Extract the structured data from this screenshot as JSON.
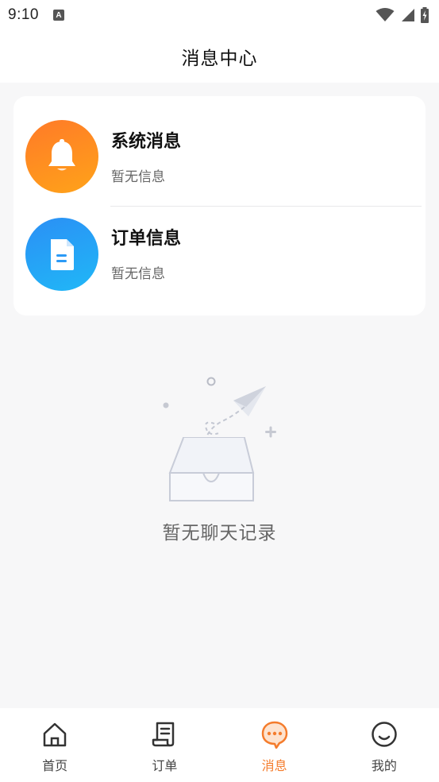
{
  "status_bar": {
    "time": "9:10",
    "icons": [
      "a-notification-icon",
      "wifi-icon",
      "signal-icon",
      "battery-charging-icon"
    ]
  },
  "header": {
    "title": "消息中心"
  },
  "messages": [
    {
      "title": "系统消息",
      "subtitle": "暂无信息",
      "icon": "bell-icon",
      "color": "#ff8a21"
    },
    {
      "title": "订单信息",
      "subtitle": "暂无信息",
      "icon": "document-icon",
      "color": "#27a3f6"
    }
  ],
  "empty_state": {
    "text": "暂无聊天记录",
    "icon": "empty-inbox-paper-plane-icon"
  },
  "tabbar": {
    "active_color": "#f47c2c",
    "items": [
      {
        "label": "首页",
        "icon": "home-icon",
        "active": false
      },
      {
        "label": "订单",
        "icon": "order-icon",
        "active": false
      },
      {
        "label": "消息",
        "icon": "message-icon",
        "active": true
      },
      {
        "label": "我的",
        "icon": "profile-smile-icon",
        "active": false
      }
    ]
  }
}
